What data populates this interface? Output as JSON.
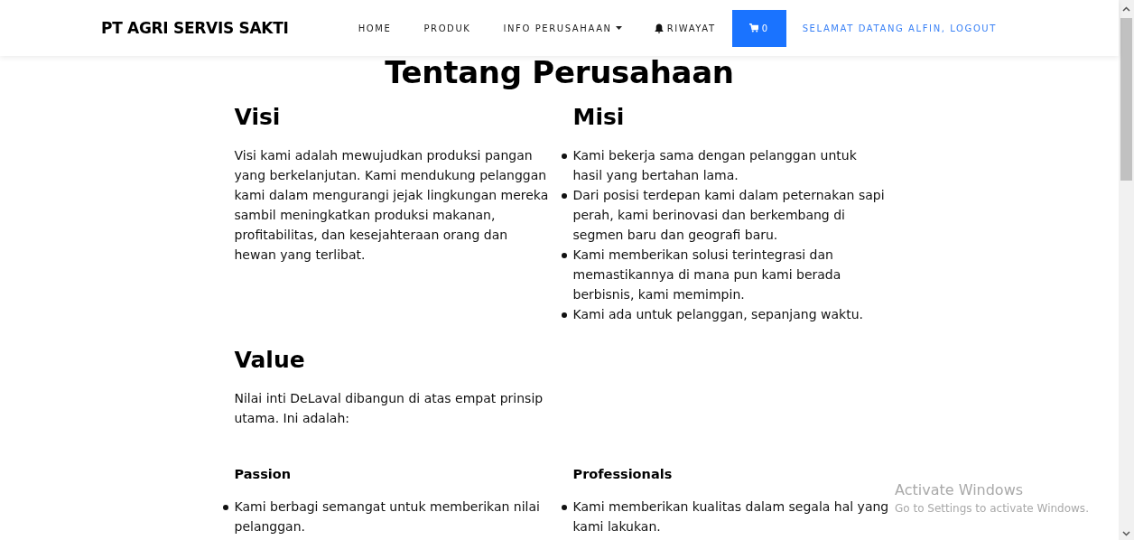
{
  "navbar": {
    "brand": "PT AGRI SERVIS SAKTI",
    "links": [
      {
        "kind": "link",
        "label": "HOME"
      },
      {
        "kind": "link",
        "label": "PRODUK"
      },
      {
        "kind": "dropdown",
        "label": "INFO PERUSAHAAN"
      },
      {
        "kind": "bell",
        "label": "RIWAYAT"
      },
      {
        "kind": "cart",
        "label": "0"
      },
      {
        "kind": "user",
        "label": "SELAMAT DATANG ALFIN, LOGOUT"
      }
    ]
  },
  "page_title": "Tentang Perusahaan",
  "sections": [
    {
      "heading": "Visi",
      "paragraph": "Visi kami adalah mewujudkan produksi pangan yang berkelanjutan. Kami mendukung pelanggan kami dalam mengurangi jejak lingkungan mereka sambil meningkatkan produksi makanan, profitabilitas, dan kesejahteraan orang dan hewan yang terlibat."
    },
    {
      "heading": "Misi",
      "bullets": [
        "Kami bekerja sama dengan pelanggan untuk hasil yang bertahan lama.",
        "Dari posisi terdepan kami dalam peternakan sapi perah, kami berinovasi dan berkembang di segmen baru dan geografi baru.",
        "Kami memberikan solusi terintegrasi dan memastikannya di mana pun kami berada berbisnis, kami memimpin.",
        "Kami ada untuk pelanggan, sepanjang waktu."
      ]
    },
    {
      "heading": "Value",
      "paragraph": "Nilai inti DeLaval dibangun di atas empat prinsip utama. Ini adalah:"
    }
  ],
  "principles": [
    {
      "heading": "Passion",
      "bullets": [
        "Kami berbagi semangat untuk memberikan nilai pelanggan."
      ]
    },
    {
      "heading": "Professionals",
      "bullets": [
        "Kami memberikan kualitas dalam segala hal yang kami lakukan."
      ]
    }
  ],
  "os_notice": {
    "title": "Activate Windows",
    "subtitle": "Go to Settings to activate Windows."
  }
}
